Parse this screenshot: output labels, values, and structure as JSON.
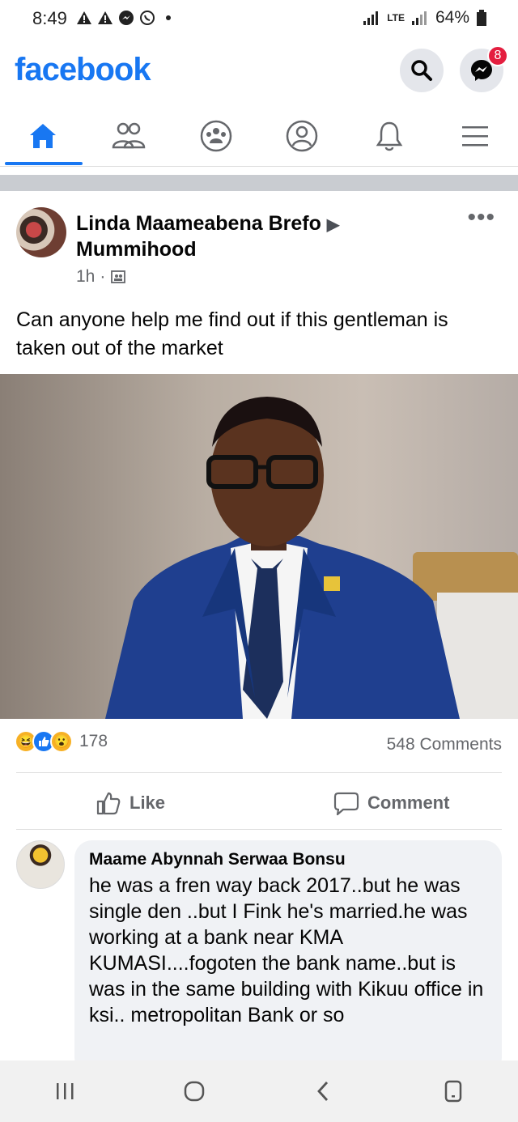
{
  "status_bar": {
    "time": "8:49",
    "network": "LTE",
    "battery": "64%"
  },
  "header": {
    "logo": "facebook",
    "messenger_badge": "8",
    "brand_color": "#1877f2"
  },
  "nav": {
    "items": [
      {
        "name": "home-icon",
        "active": true
      },
      {
        "name": "friends-icon",
        "active": false
      },
      {
        "name": "groups-icon",
        "active": false
      },
      {
        "name": "profile-icon",
        "active": false
      },
      {
        "name": "bell-icon",
        "active": false
      },
      {
        "name": "menu-icon",
        "active": false
      }
    ]
  },
  "post": {
    "author": "Linda Maameabena Brefo",
    "group": "Mummihood",
    "time": "1h",
    "text": "Can anyone help me find out if this gentleman is taken out of the market",
    "reaction_count": "178",
    "comments_count": "548 Comments",
    "like_label": "Like",
    "comment_label": "Comment"
  },
  "comment": {
    "author": "Maame Abynnah Serwaa Bonsu",
    "text": "he was a fren way back 2017..but he was single den ..but I Fink he's married.he was working at a bank near KMA KUMASI....fogoten the bank name..but is was in the same building with Kikuu office in ksi.. metropolitan Bank or so"
  }
}
